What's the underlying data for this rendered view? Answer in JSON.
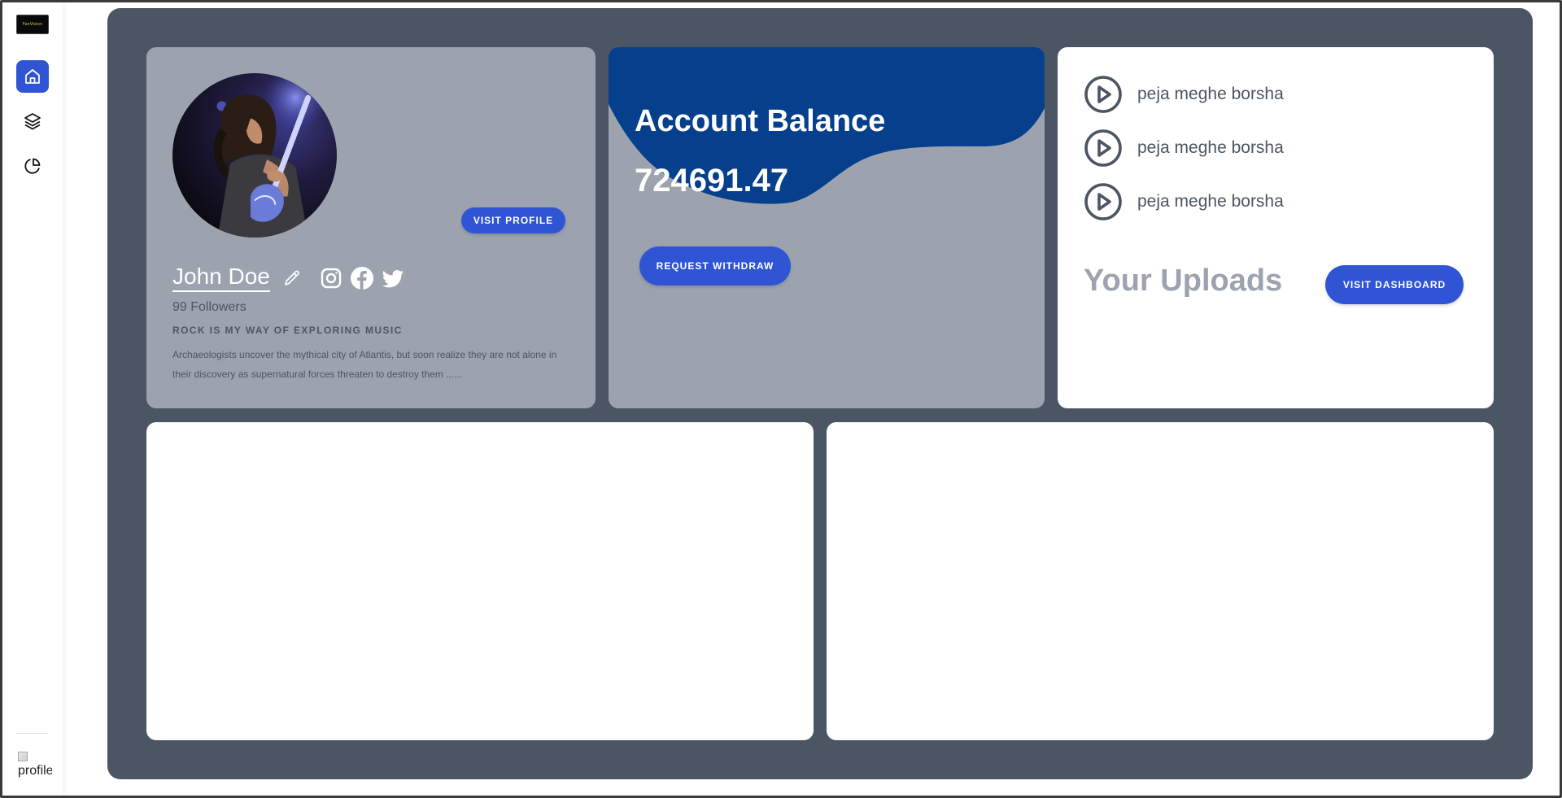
{
  "app": {
    "logo_text": "FanVision"
  },
  "sidebar": {
    "items": [
      {
        "name": "home",
        "active": true
      },
      {
        "name": "layers",
        "active": false
      },
      {
        "name": "pie-chart",
        "active": false
      }
    ],
    "profile_alt": "profile"
  },
  "profile": {
    "visit_label": "VISIT PROFILE",
    "name": "John Doe",
    "followers": "99 Followers",
    "tagline": "ROCK IS MY WAY OF EXPLORING MUSIC",
    "bio": "Archaeologists uncover the mythical city of Atlantis, but soon realize they are not alone in their discovery as supernatural forces threaten to destroy them ......",
    "socials": [
      "instagram-icon",
      "facebook-icon",
      "twitter-icon"
    ]
  },
  "balance": {
    "title": "Account Balance",
    "value": "724691.47",
    "withdraw_label": "REQUEST WITHDRAW"
  },
  "uploads": {
    "tracks": [
      {
        "title": "peja meghe borsha"
      },
      {
        "title": "peja meghe borsha"
      },
      {
        "title": "peja meghe borsha"
      }
    ],
    "title": "Your Uploads",
    "dashboard_label": "VISIT DASHBOARD"
  },
  "colors": {
    "accent": "#2f55d4",
    "panel": "#4b5563",
    "card_gray": "#9ca3af",
    "wave_blue": "#063f8c"
  }
}
